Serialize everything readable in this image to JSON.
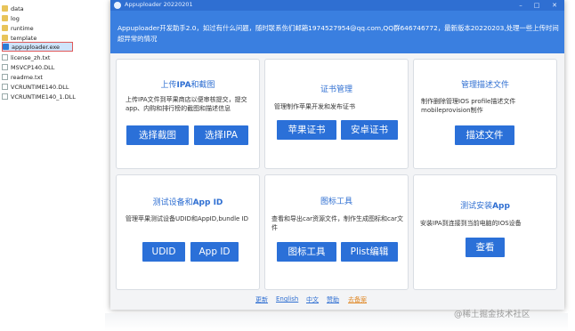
{
  "explorer": {
    "files": [
      {
        "name": "data",
        "type": "folder"
      },
      {
        "name": "log",
        "type": "folder"
      },
      {
        "name": "runtime",
        "type": "folder"
      },
      {
        "name": "template",
        "type": "folder"
      },
      {
        "name": "appuploader.exe",
        "type": "exe",
        "selected": true
      },
      {
        "name": "license_zh.txt",
        "type": "doc"
      },
      {
        "name": "MSVCP140.DLL",
        "type": "doc"
      },
      {
        "name": "readme.txt",
        "type": "doc"
      },
      {
        "name": "VCRUNTIME140.DLL",
        "type": "doc"
      },
      {
        "name": "VCRUNTIME140_1.DLL",
        "type": "doc"
      }
    ]
  },
  "window": {
    "title": "Appuploader 20220201",
    "banner_text": "Appuploader开发助手2.0，如过有什么问题，随时联系伤们邮箱1974527954@qq.com,QQ群646746772，最新版本20220203,处理一些上传时间超异常的情况",
    "cards": {
      "upload": {
        "title_prefix": "上传",
        "title_bold": "IPA",
        "title_suffix": "和截图",
        "desc": "上传IPA文件到苹果商店以便审核提交，提交app、内购和排行榜的截图和描述信息",
        "buttons": [
          "选择截图",
          "选择IPA"
        ]
      },
      "cert": {
        "title": "证书管理",
        "desc": "管理制作苹果开发和发布证书",
        "buttons": [
          "苹果证书",
          "安卓证书"
        ]
      },
      "profile": {
        "title": "管理描述文件",
        "desc": "制作删除管理IOS profile描述文件mobileprovision制作",
        "buttons": [
          "描述文件"
        ]
      },
      "devices": {
        "title_prefix": "测试设备和",
        "title_bold": "App ID",
        "desc": "管理苹果测试设备UDID和AppID,bundle ID",
        "buttons": [
          "UDID",
          "App ID"
        ]
      },
      "icons": {
        "title": "图标工具",
        "desc": "查看和导出car资源文件，制作生成图标和car文件",
        "buttons": [
          "图标工具",
          "Plist编辑"
        ]
      },
      "install": {
        "title_prefix": "测试安装",
        "title_bold": "App",
        "desc": "安装IPA到连接到当前电脑的IOS设备",
        "buttons": [
          "查看"
        ]
      }
    },
    "footer_links": [
      "更新",
      "English",
      "中文",
      "赞助",
      "去备案"
    ]
  },
  "watermark": "@稀土掘金技术社区",
  "colors": {
    "titlebar": "#2f6fd2",
    "banner": "#3a7fe0",
    "button": "#2b70d8",
    "card_title": "#2f6fd2"
  }
}
